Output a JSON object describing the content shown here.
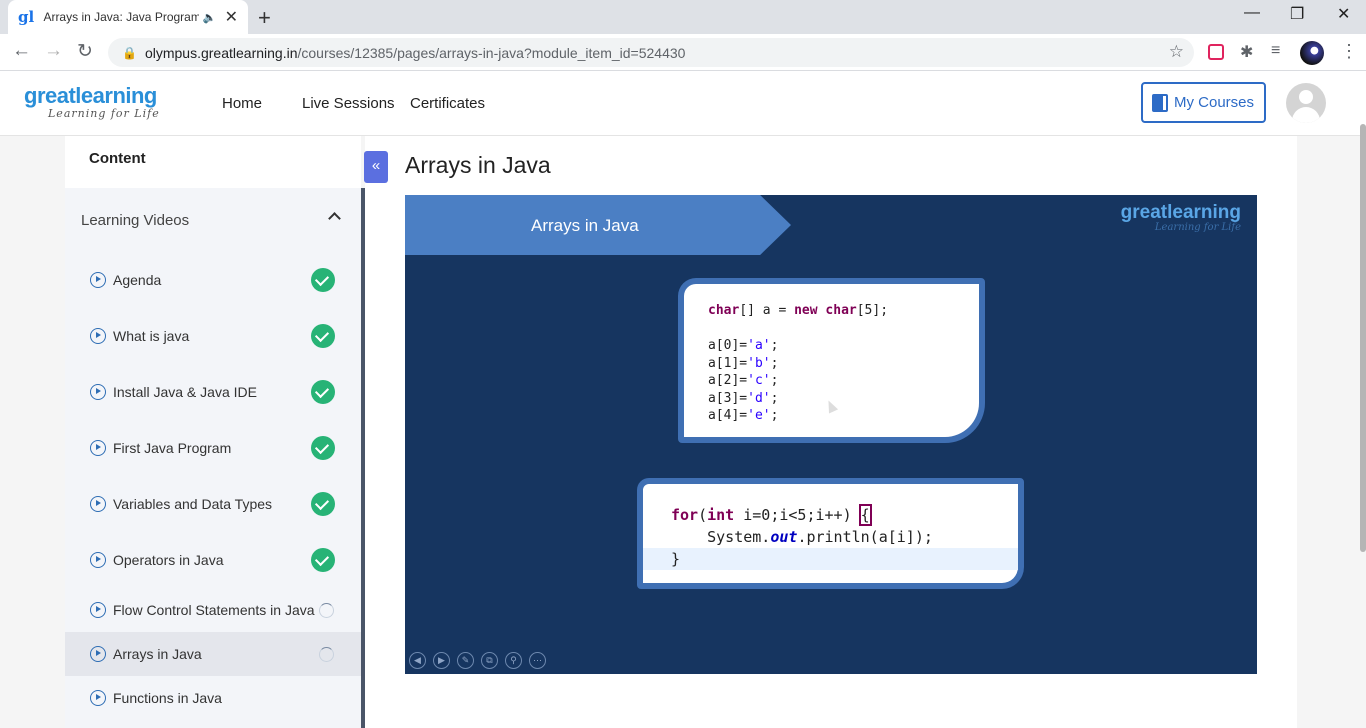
{
  "browser": {
    "tab_title": "Arrays in Java: Java Programm",
    "tab_favicon": "gl",
    "tab_audio_icon": "speaker-icon",
    "url_host": "olympus.greatlearning.in",
    "url_path": "/courses/12385/pages/arrays-in-java?module_item_id=524430"
  },
  "header": {
    "logo_main_a": "great",
    "logo_main_b": "learning",
    "logo_tagline": "Learning for Life",
    "nav": [
      "Home",
      "Live Sessions",
      "Certificates"
    ],
    "my_courses_label": "My Courses"
  },
  "sidebar": {
    "content_label": "Content",
    "section_title": "Learning Videos",
    "lessons": [
      {
        "label": "Agenda",
        "status": "completed"
      },
      {
        "label": "What is java",
        "status": "completed"
      },
      {
        "label": "Install Java & Java IDE",
        "status": "completed"
      },
      {
        "label": "First Java Program",
        "status": "completed"
      },
      {
        "label": "Variables and Data Types",
        "status": "completed"
      },
      {
        "label": "Operators in Java",
        "status": "completed"
      },
      {
        "label": "Flow Control Statements in Java",
        "status": "in-progress"
      },
      {
        "label": "Arrays in Java",
        "status": "in-progress",
        "active": true
      },
      {
        "label": "Functions in Java",
        "status": "not-started"
      }
    ],
    "collapse_icon": "«"
  },
  "main": {
    "page_title": "Arrays in Java",
    "slide": {
      "title": "Arrays in Java",
      "logo_a": "great",
      "logo_b": "learning",
      "logo_tagline": "Learning for Life",
      "code1": {
        "decl_type": "char",
        "decl_rest": "[] a = ",
        "decl_new": "new",
        "decl_space": " ",
        "decl_type2": "char",
        "decl_end": "[5];",
        "assigns": [
          {
            "lhs": "a[0]=",
            "val": "'a'"
          },
          {
            "lhs": "a[1]=",
            "val": "'b'"
          },
          {
            "lhs": "a[2]=",
            "val": "'c'"
          },
          {
            "lhs": "a[3]=",
            "val": "'d'"
          },
          {
            "lhs": "a[4]=",
            "val": "'e'"
          }
        ]
      },
      "code2": {
        "for_kw": "for",
        "open": "(",
        "int_kw": "int",
        "rest": " i=0;i<5;i++) ",
        "brace_open": "{",
        "print_a": "    System.",
        "print_out": "out",
        "print_b": ".println(a[i]);",
        "brace_close": "}"
      },
      "controls": [
        "◀",
        "▶",
        "✎",
        "⧉",
        "⚲",
        "⋯"
      ]
    }
  },
  "colors": {
    "brand_blue": "#2d6bc6",
    "completed_green": "#27b376",
    "slide_bg": "#163560"
  }
}
